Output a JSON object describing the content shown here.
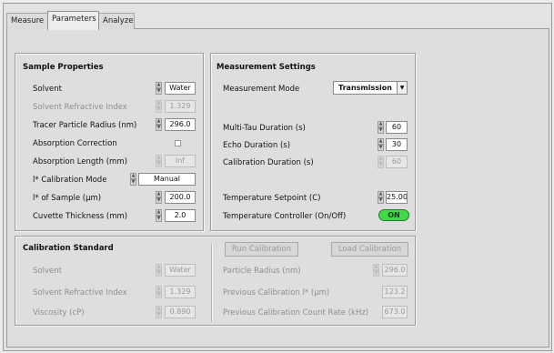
{
  "tabs": [
    {
      "label": "Measure"
    },
    {
      "label": "Parameters"
    },
    {
      "label": "Analyze"
    }
  ],
  "sample": {
    "title": "Sample Properties",
    "solvent_label": "Solvent",
    "solvent_value": "Water",
    "refractive_label": "Solvent Refractive Index",
    "refractive_value": "1.329",
    "radius_label": "Tracer Particle Radius (nm)",
    "radius_value": "296.0",
    "absorption_label": "Absorption Correction",
    "abs_length_label": "Absorption Length (mm)",
    "abs_length_value": "Inf",
    "lstar_mode_label": "l* Calibration Mode",
    "lstar_mode_value": "Manual",
    "lstar_sample_label": "l* of Sample (µm)",
    "lstar_sample_value": "200.0",
    "cuvette_label": "Cuvette Thickness (mm)",
    "cuvette_value": "2.0"
  },
  "measurement": {
    "title": "Measurement Settings",
    "mode_label": "Measurement Mode",
    "mode_value": "Transmission",
    "multitau_label": "Multi-Tau Duration (s)",
    "multitau_value": "60",
    "echo_label": "Echo Duration (s)",
    "echo_value": "30",
    "calib_dur_label": "Calibration Duration (s)",
    "calib_dur_value": "60",
    "setpoint_label": "Temperature Setpoint (C)",
    "setpoint_value": "25.00",
    "controller_label": "Temperature Controller (On/Off)",
    "controller_value": "ON"
  },
  "calibration": {
    "title": "Calibration Standard",
    "solvent_label": "Solvent",
    "solvent_value": "Water",
    "refractive_label": "Solvent Refractive Index",
    "refractive_value": "1.329",
    "viscosity_label": "Viscosity (cP)",
    "viscosity_value": "0.890",
    "run_button": "Run Calibration",
    "load_button": "Load Calibration",
    "radius_label": "Particle Radius (nm)",
    "radius_value": "296.0",
    "prev_lstar_label": "Previous Calibration l* (µm)",
    "prev_lstar_value": "123.2",
    "prev_rate_label": "Previous Calibration Count Rate (kHz)",
    "prev_rate_value": "673.0"
  },
  "colors": {
    "toggle_on": "#3fd94a",
    "panel_bg": "#dedede"
  }
}
